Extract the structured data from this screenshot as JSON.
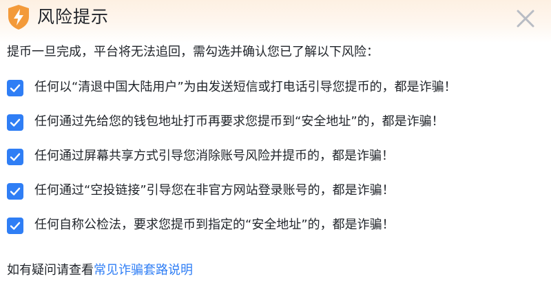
{
  "header": {
    "title": "风险提示",
    "icon": "lightning-shield-icon",
    "close_icon": "close-icon"
  },
  "intro": "提币一旦完成，平台将无法追回，需勾选并确认您已了解以下风险：",
  "risks": [
    {
      "checked": true,
      "text": "任何以“清退中国大陆用户”为由发送短信或打电话引导您提币的，都是诈骗！"
    },
    {
      "checked": true,
      "text": "任何通过先给您的钱包地址打币再要求您提币到“安全地址”的，都是诈骗！"
    },
    {
      "checked": true,
      "text": "任何通过屏幕共享方式引导您消除账号风险并提币的，都是诈骗！"
    },
    {
      "checked": true,
      "text": "任何通过“空投链接”引导您在非官方网站登录账号的，都是诈骗！"
    },
    {
      "checked": true,
      "text": "任何自称公检法，要求您提币到指定的“安全地址”的，都是诈骗！"
    }
  ],
  "footer": {
    "prefix": "如有疑问请查看",
    "link": "常见诈骗套路说明"
  },
  "colors": {
    "accent": "#2f7ef5",
    "warning": "#f39a3a",
    "header_bg": "#fdf0e2",
    "text": "#1f2329",
    "close": "#b8bcc4"
  }
}
